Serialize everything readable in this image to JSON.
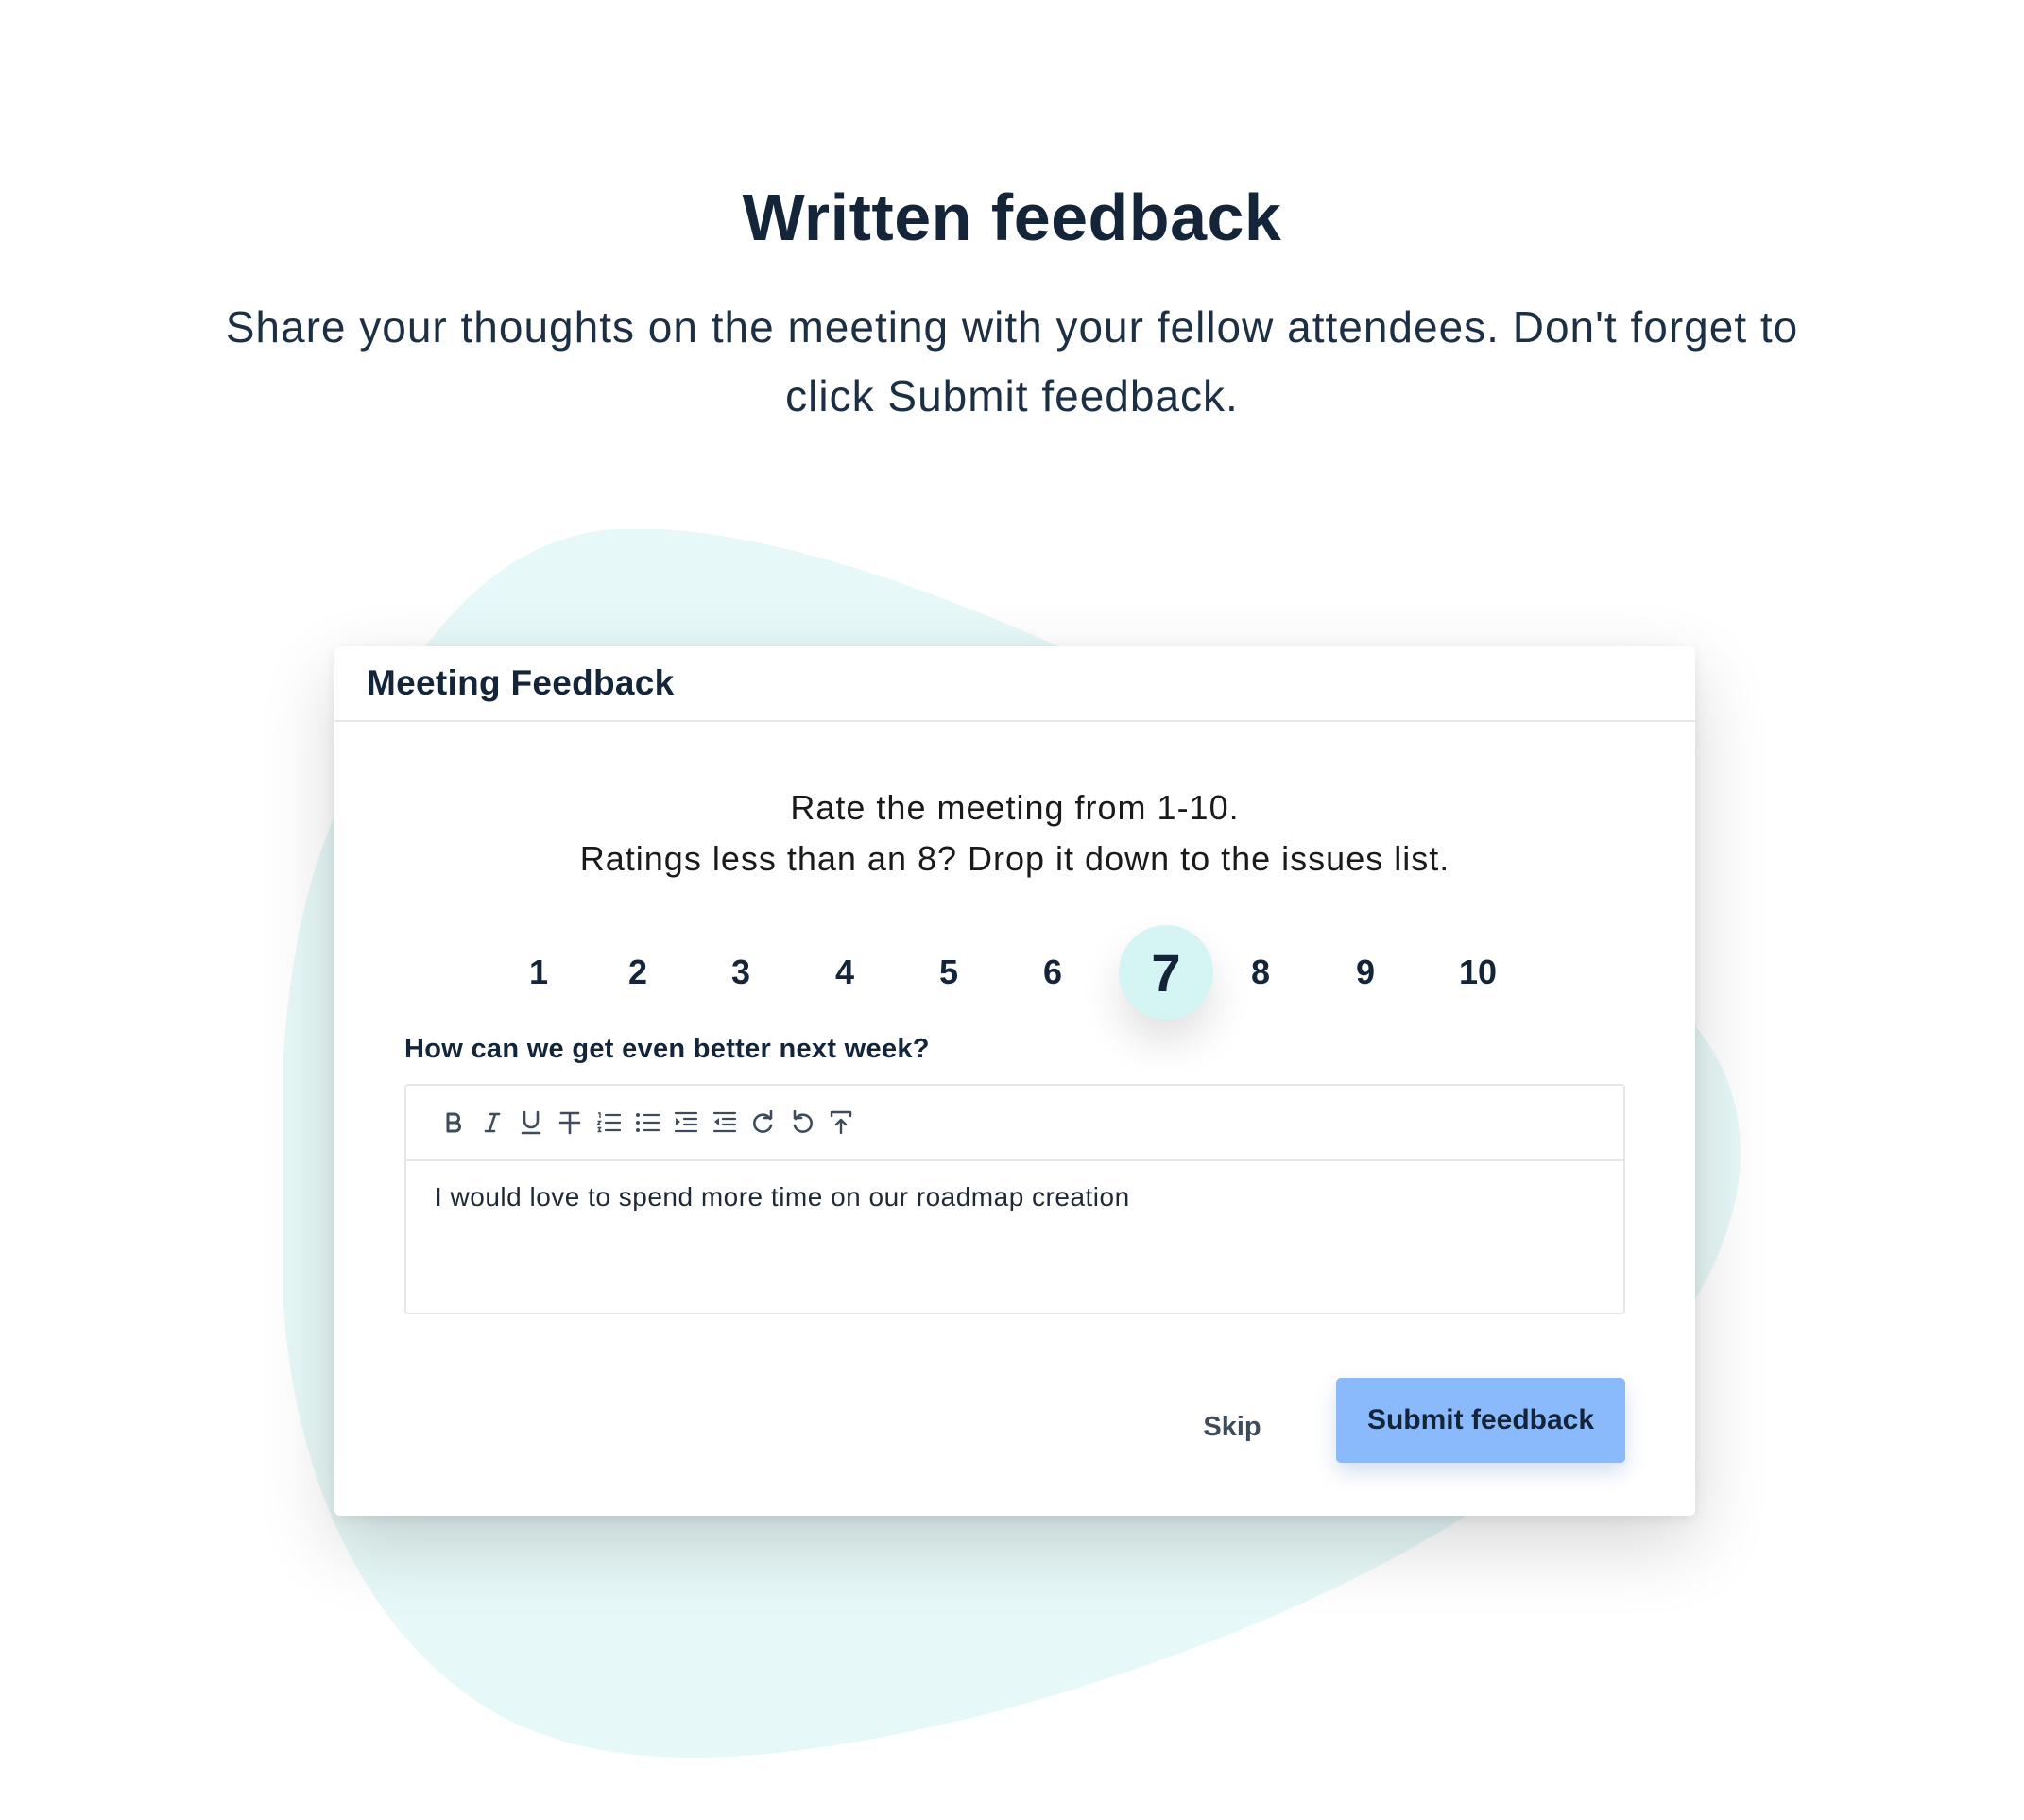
{
  "hero": {
    "title": "Written feedback",
    "subtitle": "Share your thoughts on the meeting with your fellow attendees. Don't forget to click Submit feedback."
  },
  "dialog": {
    "title": "Meeting Feedback",
    "instruction_line1": "Rate the meeting from 1-10.",
    "instruction_line2": "Ratings less than an 8? Drop it down to the issues list.",
    "ratings": [
      "1",
      "2",
      "3",
      "4",
      "5",
      "6",
      "7",
      "8",
      "9",
      "10"
    ],
    "selected_rating": "7",
    "question": "How can we get even better next week?",
    "toolbar_icons": [
      "bold-icon",
      "italic-icon",
      "underline-icon",
      "strikethrough-icon",
      "ordered-list-icon",
      "bullet-list-icon",
      "indent-icon",
      "outdent-icon",
      "redo-icon",
      "undo-icon",
      "clear-format-icon"
    ],
    "feedback_text": "I would love to spend more time on our roadmap creation",
    "skip_label": "Skip",
    "submit_label": "Submit feedback"
  },
  "colors": {
    "text_dark": "#14253a",
    "selected_rating_bg": "#d5f4f4",
    "submit_bg": "#8bbafc",
    "blob": "#e6f8f7"
  }
}
